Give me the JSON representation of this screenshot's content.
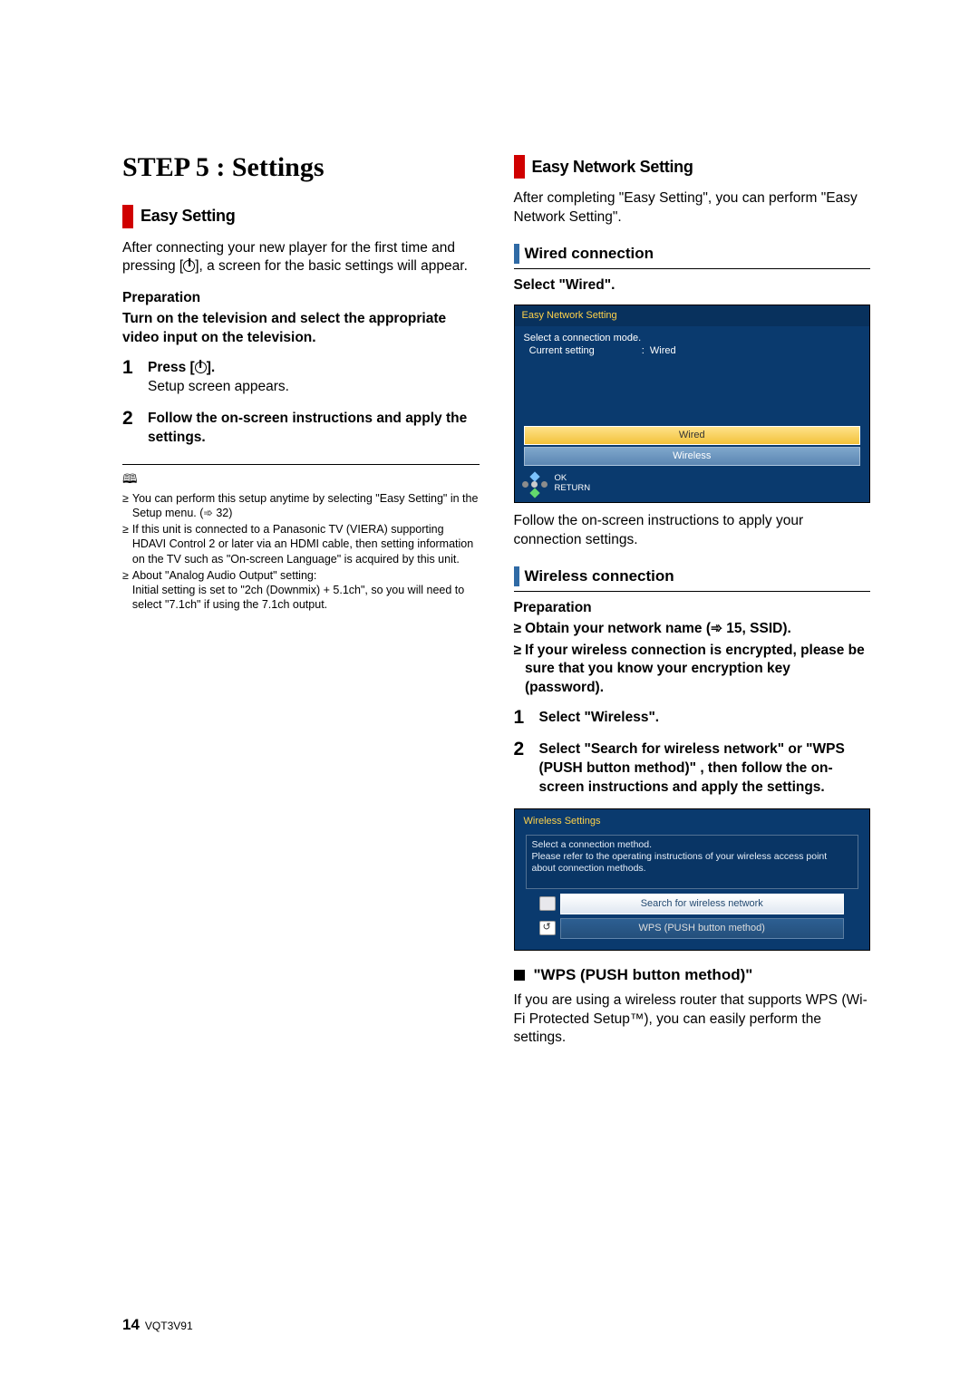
{
  "page": {
    "stepTitle": "STEP 5 : Settings",
    "footer": {
      "pageNumber": "14",
      "code": "VQT3V91"
    }
  },
  "left": {
    "easySetting": {
      "heading": "Easy Setting",
      "intro1": "After connecting your new player for the first time and pressing [",
      "intro2": "], a screen for the basic settings will appear.",
      "prepLabel": "Preparation",
      "prepText": "Turn on the television and select the appropriate video input on the television.",
      "steps": [
        {
          "boldA": "Press [",
          "boldB": "].",
          "desc": "Setup screen appears."
        },
        {
          "boldA": "Follow the on-screen instructions and apply the settings.",
          "boldB": "",
          "desc": ""
        }
      ],
      "notes": [
        "You can perform this setup anytime by selecting \"Easy Setting\" in the Setup menu. (➾ 32)",
        "If this unit is connected to a Panasonic TV (VIERA) supporting HDAVI Control 2 or later via an HDMI cable, then setting information on the TV such as \"On-screen Language\" is acquired by this unit.",
        "About \"Analog Audio Output\" setting:\nInitial setting is set to \"2ch (Downmix) + 5.1ch\", so you will need to select \"7.1ch\" if using the 7.1ch output."
      ]
    }
  },
  "right": {
    "easyNetwork": {
      "heading": "Easy Network Setting",
      "intro": "After completing \"Easy Setting\", you can perform \"Easy Network Setting\"."
    },
    "wired": {
      "heading": "Wired connection",
      "select": "Select \"Wired\".",
      "screen": {
        "title": "Easy Network Setting",
        "line1": "Select a connection mode.",
        "line2a": "Current setting",
        "line2b": ":  Wired",
        "optWired": "Wired",
        "optWireless": "Wireless",
        "ok": "OK",
        "ret": "RETURN"
      },
      "after": "Follow the on-screen instructions to apply your connection settings."
    },
    "wireless": {
      "heading": "Wireless connection",
      "prepLabel": "Preparation",
      "prepBullets": [
        "Obtain your network name (➾ 15, SSID).",
        "If your wireless connection is encrypted, please be sure that you know your encryption key (password)."
      ],
      "steps": [
        {
          "bold": "Select \"Wireless\"."
        },
        {
          "bold": "Select \"Search for wireless network\" or \"WPS (PUSH button method)\" , then follow the on-screen instructions and apply the settings."
        }
      ],
      "screen": {
        "title": "Wireless Settings",
        "instr": "Select a connection method.\nPlease refer to the operating instructions of your wireless access point about connection methods.",
        "opt1": "Search for wireless network",
        "opt2": "WPS (PUSH button method)"
      }
    },
    "wps": {
      "heading": "\"WPS (PUSH button method)\"",
      "body": "If you are using a wireless router that supports WPS (Wi-Fi Protected Setup™), you can easily perform the settings."
    }
  }
}
